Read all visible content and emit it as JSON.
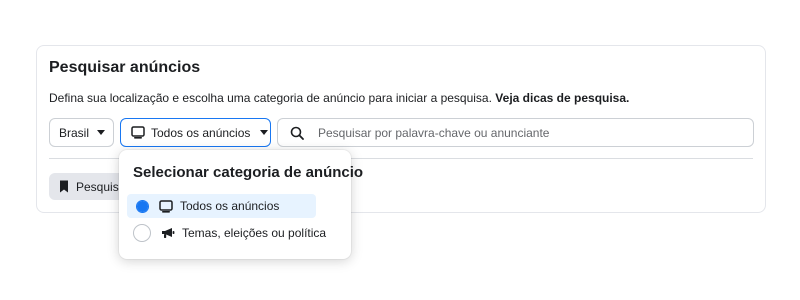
{
  "panel": {
    "title": "Pesquisar anúncios",
    "description": "Defina sua localização e escolha uma categoria de anúncio para iniciar a pesquisa.",
    "tips_link": "Veja dicas de pesquisa."
  },
  "filters": {
    "country": "Brasil",
    "category": "Todos os anúncios",
    "search_placeholder": "Pesquisar por palavra-chave ou anunciante"
  },
  "saved_button": {
    "label": "Pesquisa"
  },
  "dropdown": {
    "title": "Selecionar categoria de anúncio",
    "options": [
      {
        "label": "Todos os anúncios",
        "icon": "monitor-icon",
        "selected": true
      },
      {
        "label": "Temas, eleições ou política",
        "icon": "megaphone-icon",
        "selected": false
      }
    ]
  },
  "colors": {
    "accent": "#1877f2",
    "selected_bg": "#e7f3ff"
  }
}
